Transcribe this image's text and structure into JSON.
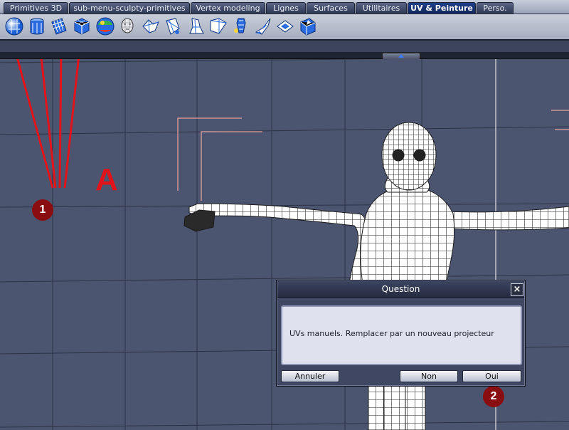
{
  "tabs": [
    {
      "label": "Primitives 3D",
      "active": false
    },
    {
      "label": "sub-menu-sculpty-primitives",
      "active": false
    },
    {
      "label": "Vertex modeling",
      "active": false
    },
    {
      "label": "Lignes",
      "active": false
    },
    {
      "label": "Surfaces",
      "active": false
    },
    {
      "label": "Utilitaires",
      "active": false
    },
    {
      "label": "UV & Peinture",
      "active": true
    },
    {
      "label": "Perso.",
      "active": false
    }
  ],
  "toolbar": {
    "icons": [
      "uv-sphere-icon",
      "uv-cylinder-icon",
      "uv-plane-icon",
      "uv-cube-icon",
      "uv-paint-sphere-icon",
      "uv-head-icon",
      "uv-unfold-icon",
      "uv-flatten-icon",
      "uv-pelt-icon",
      "uv-projector-icon",
      "uv-relax-icon",
      "uv-paint-brush-icon",
      "uv-cut-icon",
      "uv-stitch-icon",
      "uv-edit-icon"
    ]
  },
  "annotations": {
    "badge1": "1",
    "badge2": "2",
    "letter": "A",
    "color": "#e0141a"
  },
  "dialog": {
    "title": "Question",
    "message": "UVs manuels. Remplacer par un nouveau projecteur",
    "cancel_label": "Annuler",
    "no_label": "Non",
    "yes_label": "Oui",
    "close_label": "×"
  },
  "colors": {
    "viewport_bg": "#4c5570",
    "active_tab": "#1f3f8a"
  }
}
